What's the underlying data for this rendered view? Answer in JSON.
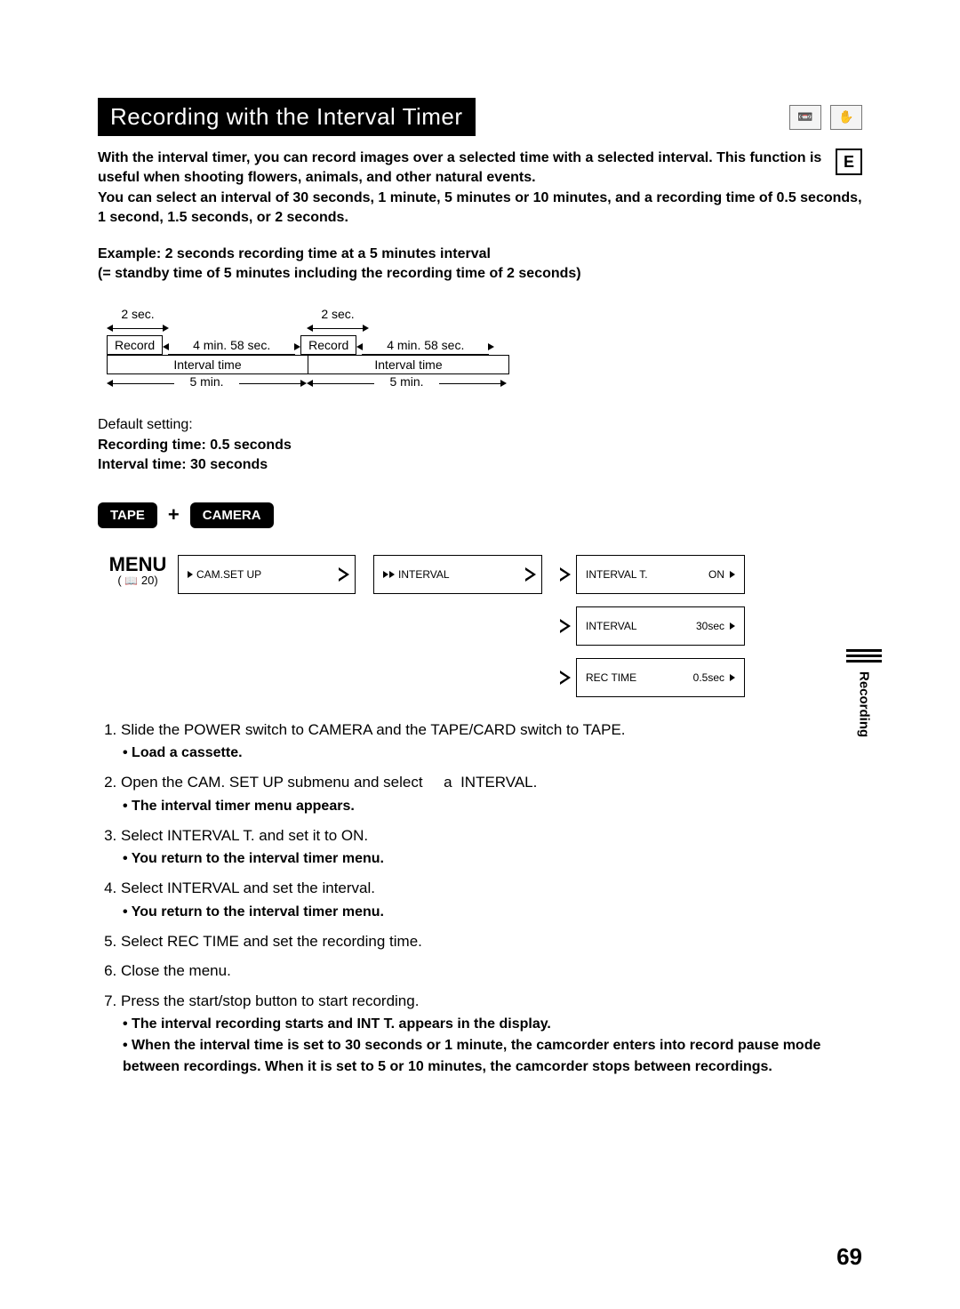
{
  "title": "Recording with the Interval Timer",
  "lang_box": "E",
  "lead": "With the interval timer, you can record images over a selected time with a selected interval. This function is useful when shooting flowers, animals, and other natural events.\nYou can select an interval of 30 seconds, 1 minute, 5 minutes or 10 minutes, and a recording time of 0.5 seconds, 1 second, 1.5 seconds, or 2 seconds.",
  "example_heading": "Example: 2 seconds recording time at a 5 minutes interval",
  "example_sub": "(= standby time of 5 minutes including the recording time of 2 seconds)",
  "diagram": {
    "rec_duration": "2 sec.",
    "gap_duration": "4 min. 58 sec.",
    "record_label": "Record",
    "interval_label": "Interval time",
    "interval_value": "5 min."
  },
  "default": {
    "prefix": "Default setting:",
    "rec": "Recording time: 0.5 seconds",
    "int": "Interval time: 30 seconds"
  },
  "mode": {
    "tape": "TAPE",
    "camera": "CAMERA",
    "plus": "+"
  },
  "menu": {
    "label": "MENU",
    "ref": "20",
    "box1": "CAM.SET UP",
    "box2": "INTERVAL",
    "box3a_l": "INTERVAL T.",
    "box3a_r": "ON",
    "box3b_l": "INTERVAL",
    "box3b_r": "30sec",
    "box3c_l": "REC TIME",
    "box3c_r": "0.5sec"
  },
  "steps": [
    {
      "t": "Slide the POWER switch to CAMERA and the TAPE/CARD switch to TAPE.",
      "sub": [
        "Load a cassette."
      ]
    },
    {
      "t": "Open the CAM. SET UP submenu and select     a  INTERVAL.",
      "sub": [
        "The interval timer menu appears."
      ]
    },
    {
      "t": "Select INTERVAL T. and set it to ON.",
      "sub": [
        "You return to the interval timer menu."
      ]
    },
    {
      "t": "Select INTERVAL and set the interval.",
      "sub": [
        "You return to the interval timer menu."
      ]
    },
    {
      "t": "Select REC TIME and set the recording time.",
      "sub": []
    },
    {
      "t": "Close the menu.",
      "sub": []
    },
    {
      "t": "Press the start/stop button to start recording.",
      "sub": [
        "The interval recording starts and INT T. appears in the display.",
        "When the interval time is set to 30 seconds or 1 minute, the camcorder enters into record pause mode between recordings. When it is set to 5 or 10 minutes, the camcorder stops between recordings."
      ]
    }
  ],
  "side_tab": "Recording",
  "page_number": "69"
}
